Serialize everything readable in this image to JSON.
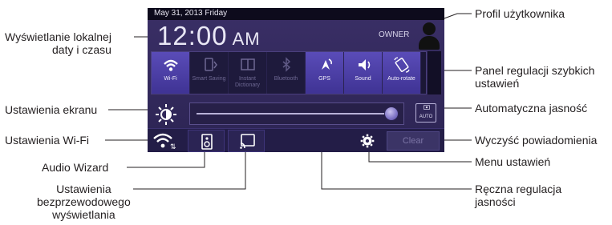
{
  "device": {
    "status_date": "May 31, 2013 Friday",
    "clock_time": "12:00",
    "clock_ampm": "AM",
    "owner_label": "OWNER",
    "quick_settings": [
      {
        "label": "Wi-Fi",
        "state": "on",
        "icon": "wifi-icon"
      },
      {
        "label": "Smart Saving",
        "state": "off",
        "icon": "smart-saving-icon"
      },
      {
        "label": "Instant Dictionary",
        "state": "off",
        "icon": "dictionary-icon"
      },
      {
        "label": "Bluetooth",
        "state": "off",
        "icon": "bluetooth-icon"
      },
      {
        "label": "GPS",
        "state": "on",
        "icon": "gps-icon"
      },
      {
        "label": "Sound",
        "state": "on",
        "icon": "sound-icon"
      },
      {
        "label": "Auto-rotate",
        "state": "on",
        "icon": "auto-rotate-icon"
      }
    ],
    "auto_brightness_label": "AUTO",
    "brightness_level": 0.96,
    "clear_label": "Clear"
  },
  "callouts": {
    "profile": "Profil użytkownika",
    "datetime": "Wyświetlanie lokalnej\ndaty i czasu",
    "quick_panel": "Panel regulacji szybkich\nustawień",
    "screen_settings": "Ustawienia ekranu",
    "auto_brightness": "Automatyczna jasność",
    "wifi_settings": "Ustawienia Wi-Fi",
    "clear_notifications": "Wyczyść powiadomienia",
    "audio_wizard": "Audio Wizard",
    "settings_menu": "Menu ustawień",
    "wireless_display": "Ustawienia\nbezprzewodowego\nwyświetlania",
    "manual_brightness": "Ręczna regulacja\njasności"
  },
  "colors": {
    "panel_bg": "#2c2453",
    "tile_active": "#4f42a8",
    "tile_inactive": "#1e1a3c",
    "callout_text": "#231f20"
  }
}
